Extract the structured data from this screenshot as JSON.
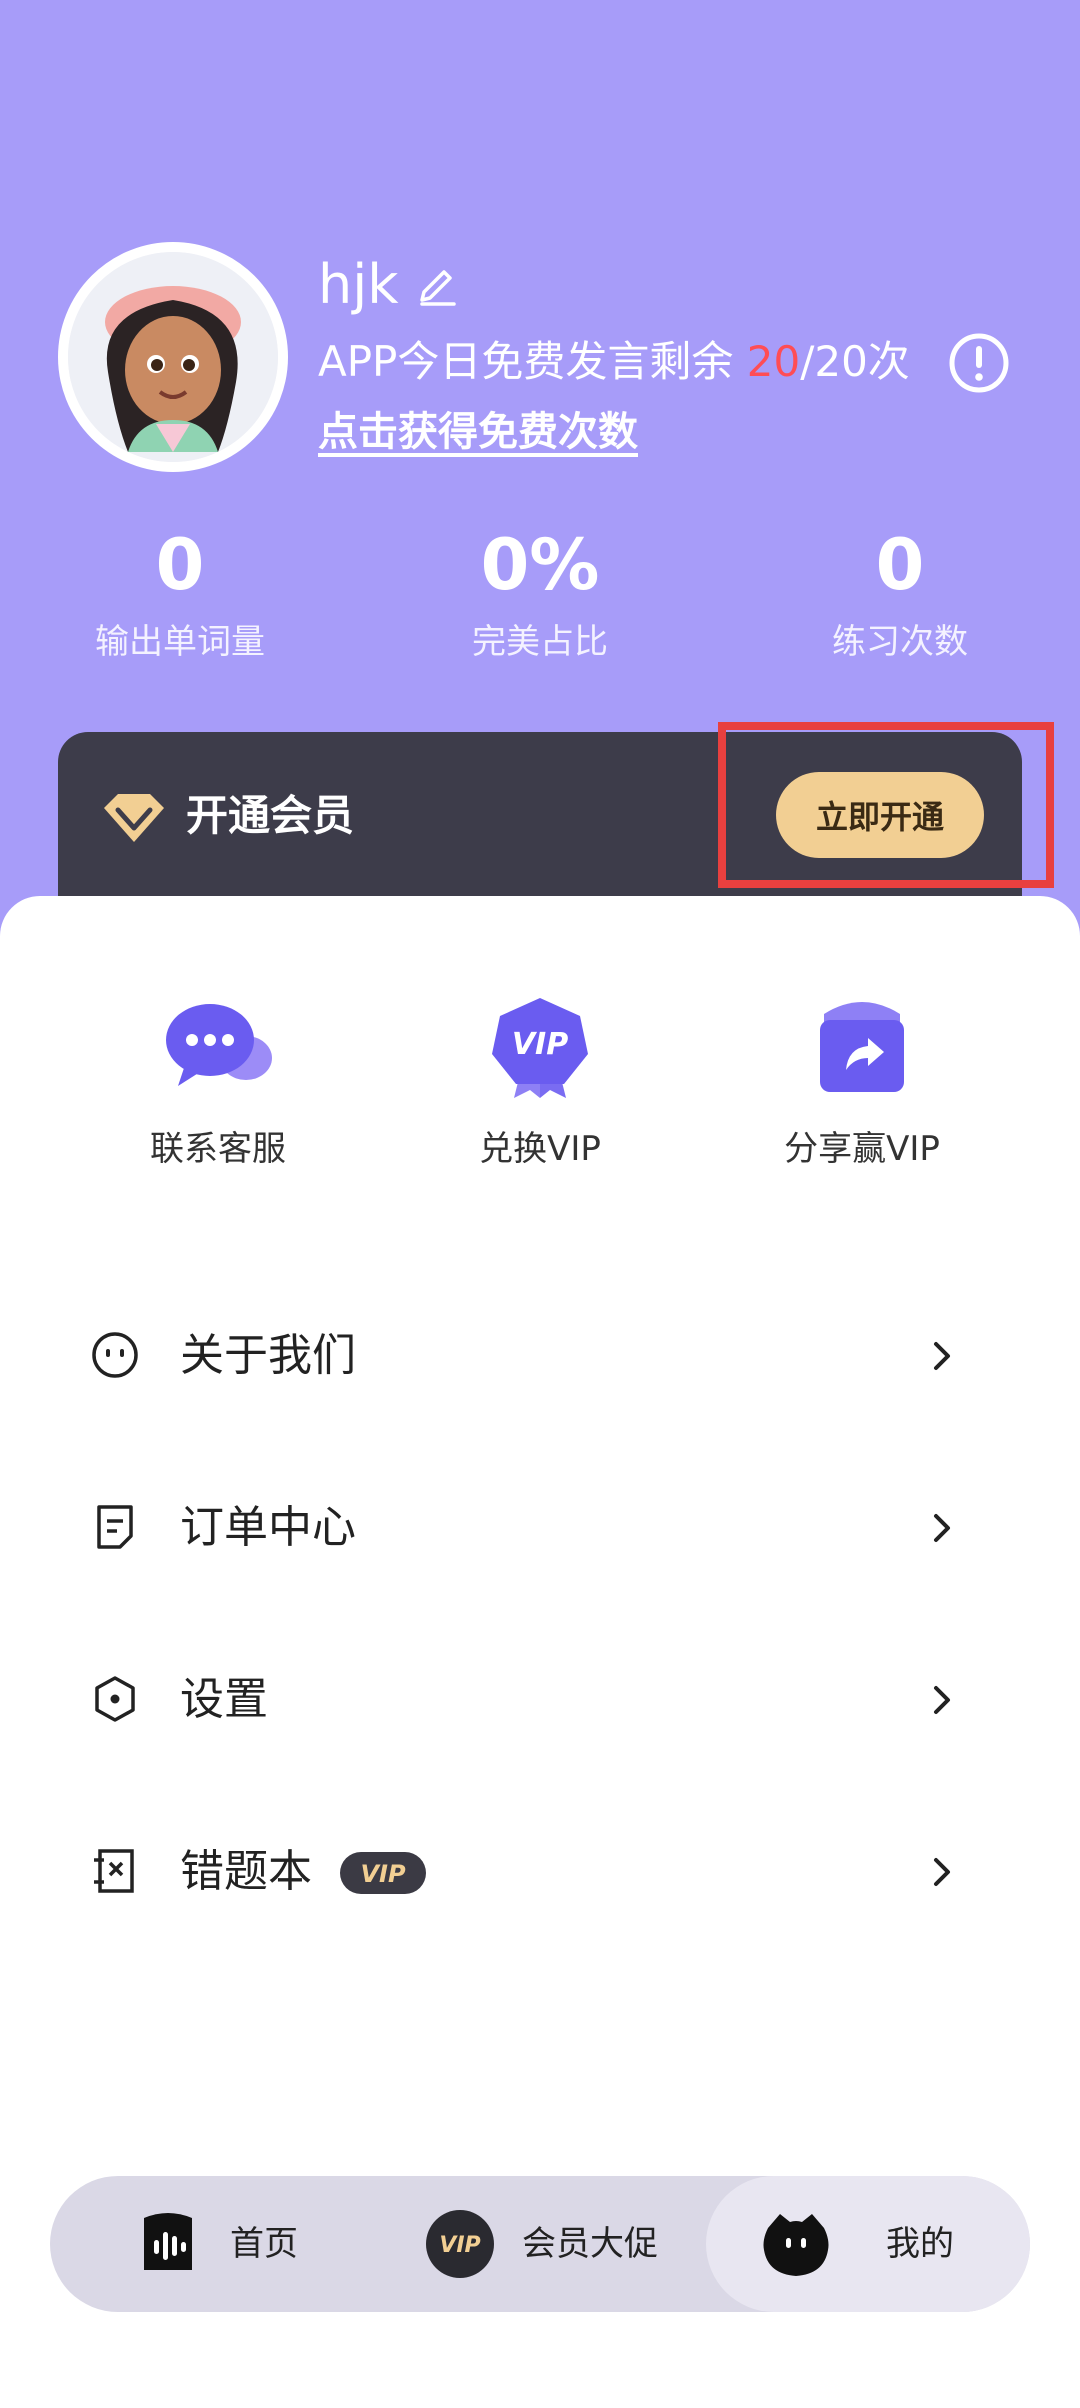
{
  "profile": {
    "username": "hjk",
    "quota_prefix": "APP今日免费发言剩余 ",
    "quota_remaining": "20",
    "quota_total": "/20次",
    "free_link": "点击获得免费次数"
  },
  "stats": [
    {
      "value": "0",
      "label": "输出单词量"
    },
    {
      "value": "0%",
      "label": "完美占比"
    },
    {
      "value": "0",
      "label": "练习次数"
    }
  ],
  "vip": {
    "title": "开通会员",
    "button": "立即开通"
  },
  "quick_actions": [
    {
      "label": "联系客服",
      "icon": "chat-bubbles-icon"
    },
    {
      "label": "兑换VIP",
      "icon": "vip-badge-icon"
    },
    {
      "label": "分享赢VIP",
      "icon": "share-envelope-icon"
    }
  ],
  "menu": [
    {
      "label": "关于我们",
      "icon": "smile-face-icon"
    },
    {
      "label": "订单中心",
      "icon": "document-icon"
    },
    {
      "label": "设置",
      "icon": "hexagon-settings-icon"
    },
    {
      "label": "错题本",
      "icon": "mistake-book-icon",
      "badge": "VIP"
    }
  ],
  "tabs": [
    {
      "label": "首页",
      "icon": "voice-wave-icon",
      "active": false
    },
    {
      "label": "会员大促",
      "icon": "vip-circle-icon",
      "active": false
    },
    {
      "label": "我的",
      "icon": "mascot-icon",
      "active": true
    }
  ],
  "colors": {
    "hero_bg": "#a79cf9",
    "accent_red": "#ff4d55",
    "vip_card": "#3d3c4a",
    "vip_gold": "#f2cf93",
    "highlight": "#e8403f"
  }
}
